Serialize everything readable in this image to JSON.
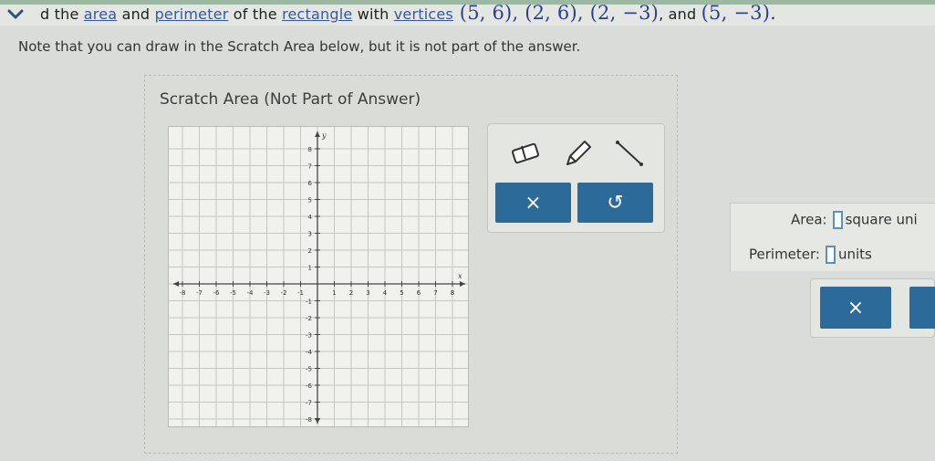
{
  "question": {
    "prefix": "d the ",
    "area_link": "area",
    "and1": " and ",
    "perimeter_link": "perimeter",
    "of_the": " of the ",
    "rectangle_link": "rectangle",
    "with": " with ",
    "vertices_link": "vertices",
    "v1": " (5, 6), (2, 6), (2, −3)",
    "and2": ", and ",
    "v4": "(5, −3)."
  },
  "note": "Note that you can draw in the Scratch Area below, but it is not part of the answer.",
  "scratch": {
    "title": "Scratch Area (Not Part of Answer)",
    "graph": {
      "x_label": "x",
      "y_label": "y",
      "x_ticks": [
        "-8",
        "-7",
        "-6",
        "-5",
        "-4",
        "-3",
        "-2",
        "-1",
        "1",
        "2",
        "3",
        "4",
        "5",
        "6",
        "7",
        "8"
      ],
      "y_ticks": [
        "8",
        "7",
        "6",
        "5",
        "4",
        "3",
        "2",
        "1",
        "-1",
        "-2",
        "-3",
        "-4",
        "-5",
        "-6",
        "-7",
        "-8"
      ]
    },
    "tools": {
      "eraser": "eraser-icon",
      "pencil": "pencil-icon",
      "line": "line-tool-icon",
      "clear_label": "×",
      "undo_label": "↺"
    }
  },
  "answer": {
    "area_label": "Area:",
    "area_unit": "square uni",
    "perimeter_label": "Perimeter:",
    "perimeter_unit": "units",
    "clear_label": "×"
  },
  "colors": {
    "button_blue": "#2c6a9a",
    "link_blue": "#3657a8"
  }
}
